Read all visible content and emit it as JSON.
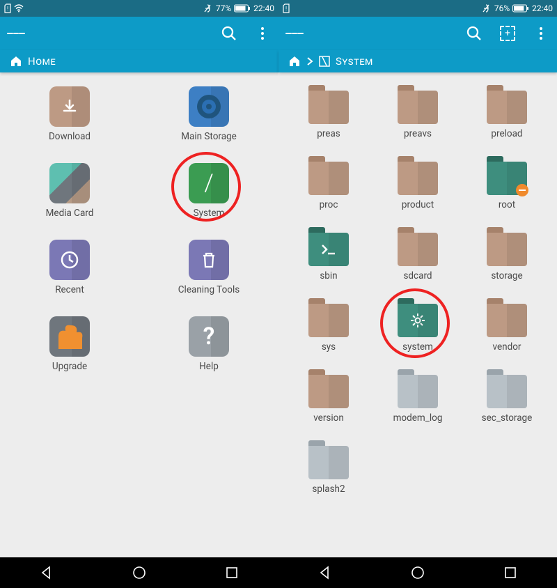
{
  "left": {
    "status": {
      "battery_pct": "77%",
      "time": "22:40"
    },
    "breadcrumb": {
      "label": "Home"
    },
    "grid": [
      {
        "id": "download",
        "label": "Download",
        "kind": "tile-brown",
        "glyph": "download"
      },
      {
        "id": "main-storage",
        "label": "Main Storage",
        "kind": "tile-mainstorage",
        "glyph": "storage"
      },
      {
        "id": "media-card",
        "label": "Media Card",
        "kind": "tile-mediacard",
        "glyph": ""
      },
      {
        "id": "system",
        "label": "System",
        "kind": "tile-green",
        "glyph": "slash",
        "highlight": true
      },
      {
        "id": "recent",
        "label": "Recent",
        "kind": "tile-purple",
        "glyph": "clock"
      },
      {
        "id": "cleaning",
        "label": "Cleaning Tools",
        "kind": "tile-purple",
        "glyph": "trash"
      },
      {
        "id": "upgrade",
        "label": "Upgrade",
        "kind": "tile-upgrade",
        "glyph": "puzzle"
      },
      {
        "id": "help",
        "label": "Help",
        "kind": "tile-grey",
        "glyph": "question"
      }
    ]
  },
  "right": {
    "status": {
      "battery_pct": "76%",
      "time": "22:40"
    },
    "breadcrumb": {
      "root_icon": "home",
      "path_label": "System"
    },
    "grid": [
      {
        "id": "preas",
        "label": "preas",
        "kind": "folder"
      },
      {
        "id": "preavs",
        "label": "preavs",
        "kind": "folder"
      },
      {
        "id": "preload",
        "label": "preload",
        "kind": "folder"
      },
      {
        "id": "proc",
        "label": "proc",
        "kind": "folder"
      },
      {
        "id": "product",
        "label": "product",
        "kind": "folder"
      },
      {
        "id": "root",
        "label": "root",
        "kind": "folder-teal",
        "glyph": "minus-badge"
      },
      {
        "id": "sbin",
        "label": "sbin",
        "kind": "folder-teal",
        "glyph": "terminal"
      },
      {
        "id": "sdcard",
        "label": "sdcard",
        "kind": "folder"
      },
      {
        "id": "storage",
        "label": "storage",
        "kind": "folder"
      },
      {
        "id": "sys",
        "label": "sys",
        "kind": "folder"
      },
      {
        "id": "system",
        "label": "system",
        "kind": "folder-teal",
        "glyph": "gear",
        "highlight": true
      },
      {
        "id": "vendor",
        "label": "vendor",
        "kind": "folder"
      },
      {
        "id": "version",
        "label": "version",
        "kind": "folder"
      },
      {
        "id": "modem_log",
        "label": "modem_log",
        "kind": "folder-grey"
      },
      {
        "id": "sec_storage",
        "label": "sec_storage",
        "kind": "folder-grey"
      },
      {
        "id": "splash2",
        "label": "splash2",
        "kind": "folder-grey"
      }
    ]
  }
}
